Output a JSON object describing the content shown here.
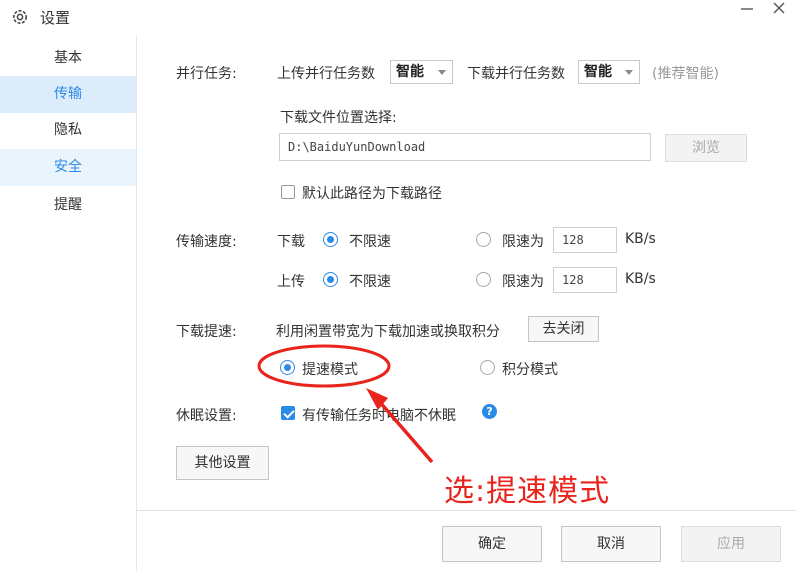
{
  "window": {
    "title": "设置",
    "minimize_glyph": "–",
    "close_glyph": "✕"
  },
  "sidebar": {
    "items": [
      {
        "label": "基本"
      },
      {
        "label": "传输"
      },
      {
        "label": "隐私"
      },
      {
        "label": "安全"
      },
      {
        "label": "提醒"
      }
    ]
  },
  "parallel": {
    "label": "并行任务:",
    "upload_label": "上传并行任务数",
    "upload_value": "智能",
    "download_label": "下载并行任务数",
    "download_value": "智能",
    "hint": "(推荐智能)"
  },
  "download_location": {
    "label": "下载文件位置选择:",
    "path": "D:\\BaiduYunDownload",
    "browse_label": "浏览",
    "default_checkbox_label": "默认此路径为下载路径",
    "default_checked": false
  },
  "speed": {
    "label": "传输速度:",
    "download": {
      "label": "下载",
      "unlimited_label": "不限速",
      "limit_label": "限速为",
      "limit_value": "128",
      "unit": "KB/s",
      "selected": "unlimited"
    },
    "upload": {
      "label": "上传",
      "unlimited_label": "不限速",
      "limit_label": "限速为",
      "limit_value": "128",
      "unit": "KB/s",
      "selected": "unlimited"
    }
  },
  "boost": {
    "label": "下载提速:",
    "description": "利用闲置带宽为下载加速或换取积分",
    "toggle_button": "去关闭",
    "mode_speed_label": "提速模式",
    "mode_points_label": "积分模式",
    "selected": "speed"
  },
  "sleep": {
    "label": "休眠设置:",
    "checkbox_label": "有传输任务时电脑不休眠",
    "checked": true
  },
  "other_settings_label": "其他设置",
  "footer": {
    "ok_label": "确定",
    "cancel_label": "取消",
    "apply_label": "应用"
  },
  "annotation": {
    "text": "选:提速模式",
    "color": "#e8241c"
  },
  "colors": {
    "accent": "#2a8ae8",
    "sidebar_active_bg": "#ddecfa"
  }
}
